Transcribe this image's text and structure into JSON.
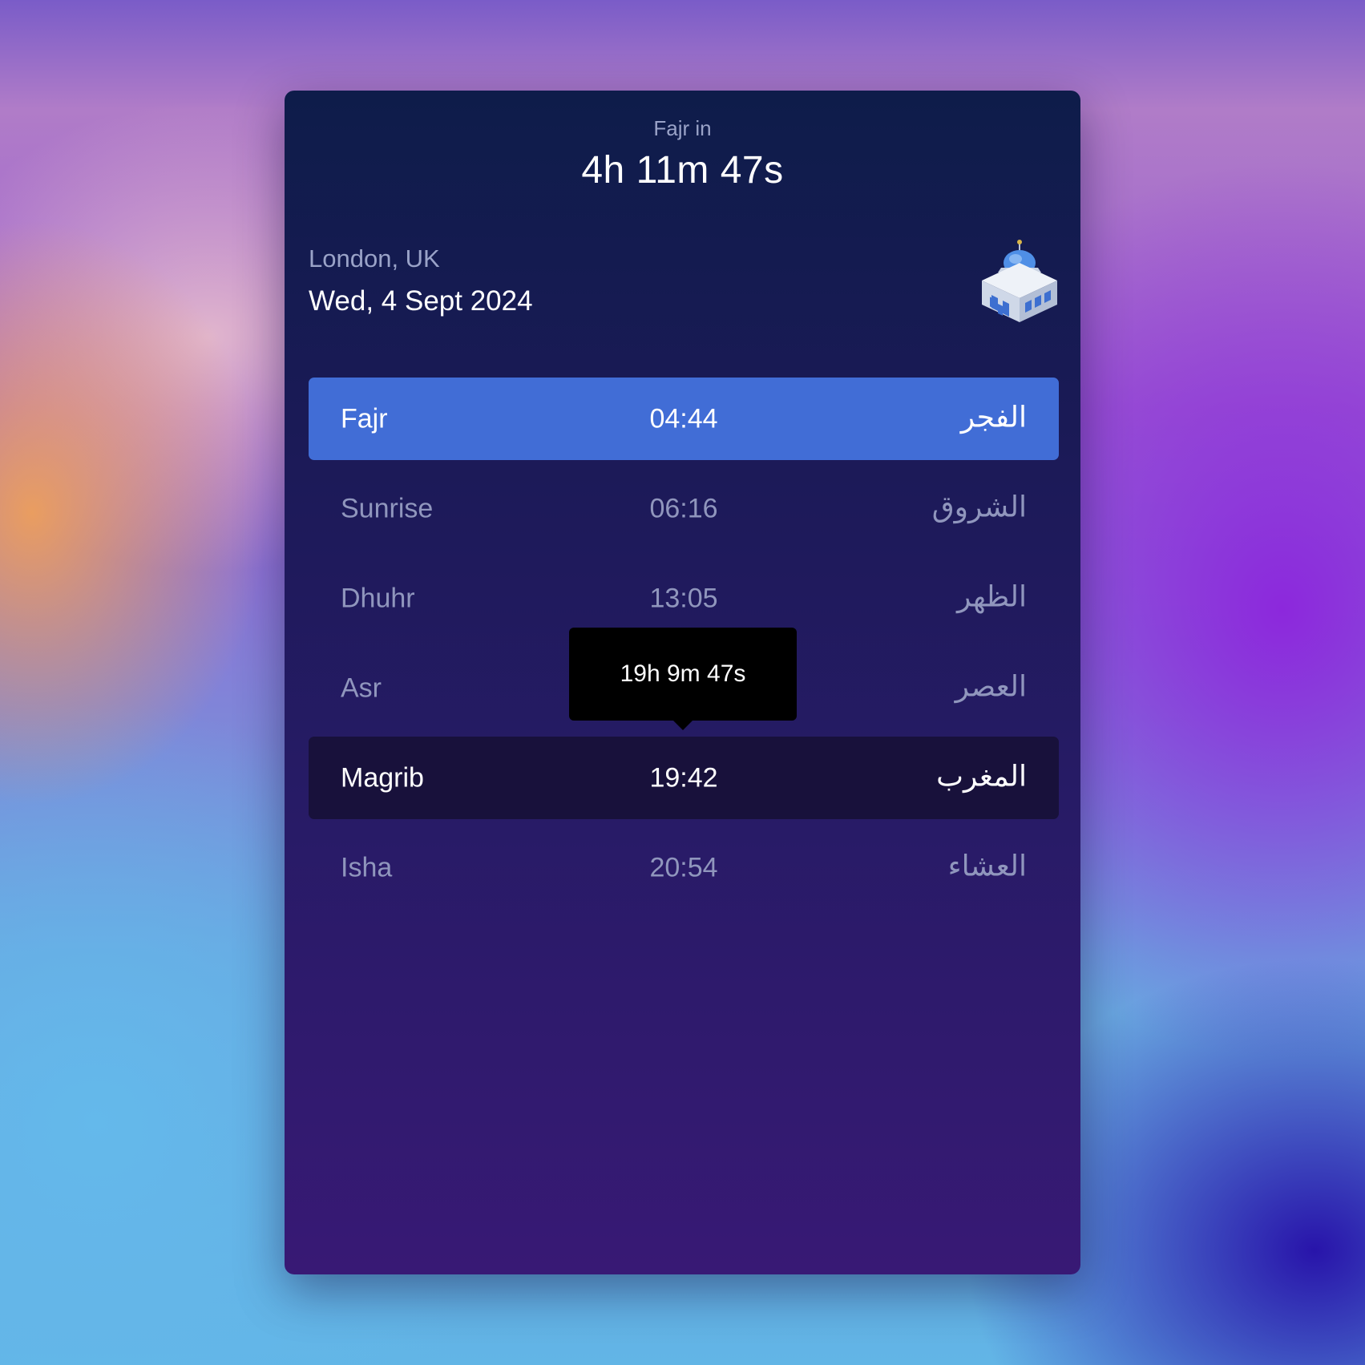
{
  "countdown": {
    "label": "Fajr in",
    "value": "4h 11m 47s"
  },
  "location": "London, UK",
  "date": "Wed, 4 Sept 2024",
  "icons": {
    "app_icon": "mosque-icon"
  },
  "colors": {
    "active_row": "#416dd6",
    "selected_row": "#18113b",
    "tooltip_bg": "#000000"
  },
  "prayers": [
    {
      "name": "Fajr",
      "time": "04:44",
      "arabic": "الفجر",
      "state": "active"
    },
    {
      "name": "Sunrise",
      "time": "06:16",
      "arabic": "الشروق",
      "state": "normal"
    },
    {
      "name": "Dhuhr",
      "time": "13:05",
      "arabic": "الظهر",
      "state": "normal"
    },
    {
      "name": "Asr",
      "time": "",
      "arabic": "العصر",
      "state": "normal"
    },
    {
      "name": "Magrib",
      "time": "19:42",
      "arabic": "المغرب",
      "state": "selected"
    },
    {
      "name": "Isha",
      "time": "20:54",
      "arabic": "العشاء",
      "state": "normal"
    }
  ],
  "tooltip": {
    "text": "19h 9m 47s"
  }
}
